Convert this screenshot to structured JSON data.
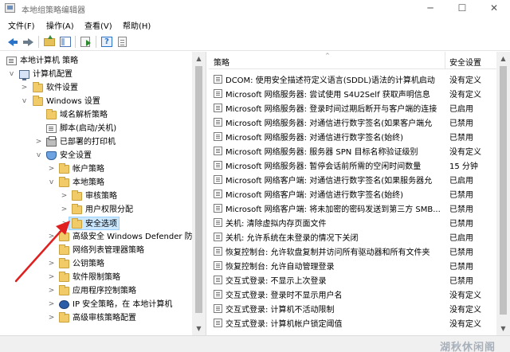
{
  "window": {
    "title": "本地组策略编辑器",
    "minimize_symbol": "─",
    "maximize_symbol": "☐",
    "close_symbol": "✕"
  },
  "menu": [
    "文件(F)",
    "操作(A)",
    "查看(V)",
    "帮助(H)"
  ],
  "toolbar": {
    "icons": [
      "back-arrow-icon",
      "forward-arrow-icon",
      "up-folder-icon",
      "show-hide-tree-icon",
      "properties-icon",
      "export-list-icon",
      "help-icon"
    ],
    "help_glyph": "?"
  },
  "tree": {
    "expand_glyph": ">",
    "collapse_glyph": "v",
    "items": [
      {
        "label": "本地计算机 策略",
        "icon": "document-icon"
      },
      {
        "label": "计算机配置",
        "icon": "computer-icon"
      },
      {
        "label": "软件设置",
        "icon": "folder-icon"
      },
      {
        "label": "Windows 设置",
        "icon": "folder-icon"
      },
      {
        "label": "域名解析策略",
        "icon": "folder-icon"
      },
      {
        "label": "脚本(启动/关机)",
        "icon": "document-icon"
      },
      {
        "label": "已部署的打印机",
        "icon": "printer-icon"
      },
      {
        "label": "安全设置",
        "icon": "shield-icon"
      },
      {
        "label": "帐户策略",
        "icon": "folder-icon"
      },
      {
        "label": "本地策略",
        "icon": "folder-icon"
      },
      {
        "label": "审核策略",
        "icon": "folder-icon"
      },
      {
        "label": "用户权限分配",
        "icon": "folder-icon"
      },
      {
        "label": "安全选项",
        "icon": "folder-icon",
        "selected": true
      },
      {
        "label": "高级安全 Windows Defender 防",
        "icon": "folder-icon"
      },
      {
        "label": "网络列表管理器策略",
        "icon": "folder-icon"
      },
      {
        "label": "公钥策略",
        "icon": "folder-icon"
      },
      {
        "label": "软件限制策略",
        "icon": "folder-icon"
      },
      {
        "label": "应用程序控制策略",
        "icon": "folder-icon"
      },
      {
        "label": "IP 安全策略，在 本地计算机",
        "icon": "network-icon"
      },
      {
        "label": "高级审核策略配置",
        "icon": "folder-icon"
      }
    ]
  },
  "list": {
    "col_policy": "策略",
    "col_setting": "安全设置",
    "rows": [
      {
        "name": "DCOM: 使用安全描述符定义语言(SDDL)语法的计算机启动",
        "value": "没有定义"
      },
      {
        "name": "Microsoft 网络服务器: 尝试使用 S4U2Self 获取声明信息",
        "value": "没有定义"
      },
      {
        "name": "Microsoft 网络服务器: 登录时间过期后断开与客户端的连接",
        "value": "已启用"
      },
      {
        "name": "Microsoft 网络服务器: 对通信进行数字签名(如果客户端允",
        "value": "已禁用"
      },
      {
        "name": "Microsoft 网络服务器: 对通信进行数字签名(始终)",
        "value": "已禁用"
      },
      {
        "name": "Microsoft 网络服务器: 服务器 SPN 目标名称验证级别",
        "value": "没有定义"
      },
      {
        "name": "Microsoft 网络服务器: 暂停会话前所需的空闲时间数量",
        "value": "15 分钟"
      },
      {
        "name": "Microsoft 网络客户端: 对通信进行数字签名(如果服务器允",
        "value": "已启用"
      },
      {
        "name": "Microsoft 网络客户端: 对通信进行数字签名(始终)",
        "value": "已禁用"
      },
      {
        "name": "Microsoft 网络客户端: 将未加密的密码发送到第三方 SMB...",
        "value": "已禁用"
      },
      {
        "name": "关机: 清除虚拟内存页面文件",
        "value": "已禁用"
      },
      {
        "name": "关机: 允许系统在未登录的情况下关闭",
        "value": "已启用"
      },
      {
        "name": "恢复控制台: 允许软盘复制并访问所有驱动器和所有文件夹",
        "value": "已禁用"
      },
      {
        "name": "恢复控制台: 允许自动管理登录",
        "value": "已禁用"
      },
      {
        "name": "交互式登录: 不显示上次登录",
        "value": "已禁用"
      },
      {
        "name": "交互式登录: 登录时不显示用户名",
        "value": "没有定义"
      },
      {
        "name": "交互式登录: 计算机不活动限制",
        "value": "没有定义"
      },
      {
        "name": "交互式登录: 计算机帐户锁定阈值",
        "value": "没有定义"
      }
    ]
  },
  "scroll": {
    "up_glyph": "▲",
    "down_glyph": "▼",
    "sort_glyph": "^"
  },
  "watermark": "湖秋休闲阁",
  "colors": {
    "selection": "#cce8ff",
    "annotation_arrow": "#e02020"
  }
}
